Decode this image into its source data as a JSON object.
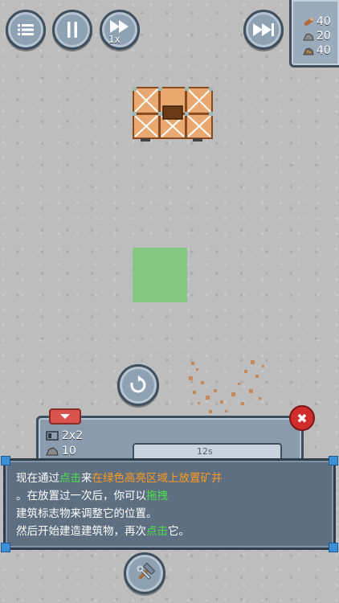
{
  "hud": {
    "speed_label": "1x",
    "resources": [
      {
        "icon": "wood-log-icon",
        "value": "40"
      },
      {
        "icon": "stone-icon",
        "value": "20"
      },
      {
        "icon": "ore-icon",
        "value": "40"
      }
    ]
  },
  "build_panel": {
    "size": "2x2",
    "cost": "10",
    "card_text": "12s"
  },
  "tutorial": {
    "line1": [
      {
        "text": "现在通过",
        "style": "normal"
      },
      {
        "text": "点击",
        "style": "green"
      },
      {
        "text": "来",
        "style": "normal"
      },
      {
        "text": "在绿色高亮区域上放置矿井",
        "style": "orange"
      }
    ],
    "line2": [
      {
        "text": "。在放置过一次后，你可以",
        "style": "normal"
      },
      {
        "text": "拖拽",
        "style": "green"
      }
    ],
    "line3": [
      {
        "text": "建筑标志物来调整它的位置。",
        "style": "normal"
      }
    ],
    "line4": [
      {
        "text": "然后开始建造建筑物，再次",
        "style": "normal"
      },
      {
        "text": "点击",
        "style": "green"
      },
      {
        "text": "它。",
        "style": "normal"
      }
    ]
  },
  "colors": {
    "highlight_zone": "#7ec77a",
    "text_green": "#4be04b",
    "text_orange": "#ff9a1f",
    "close_red": "#d22d2d"
  }
}
